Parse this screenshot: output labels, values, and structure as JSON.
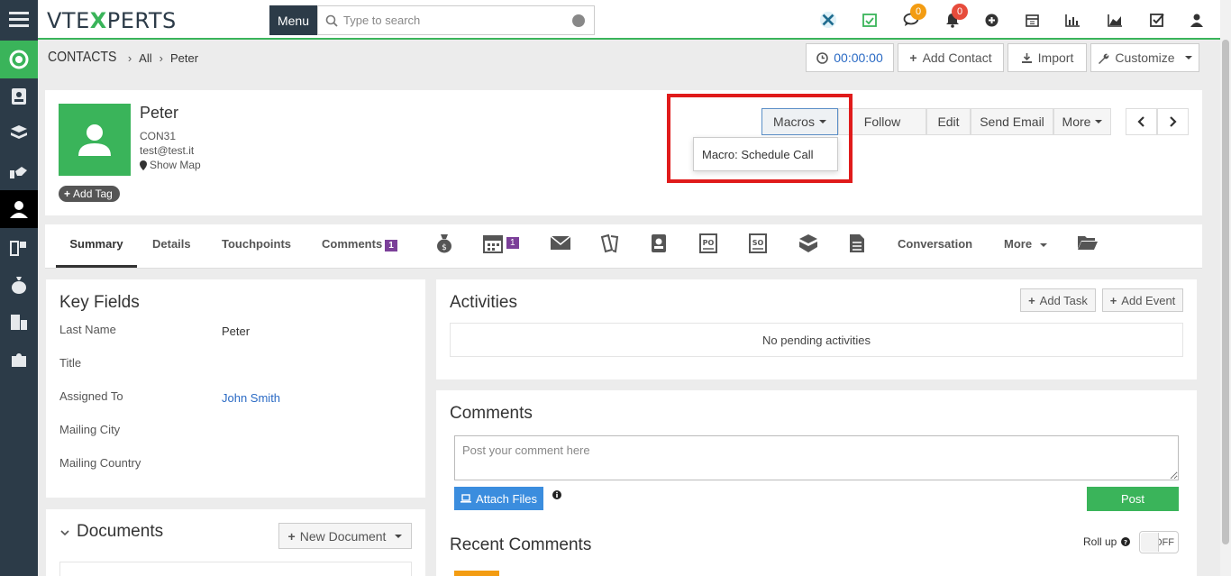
{
  "app": {
    "logo": "VTEXPERTS",
    "menu_label": "Menu"
  },
  "search": {
    "placeholder": "Type to search"
  },
  "topbar": {
    "badges": {
      "chat": "0",
      "notifications": "0"
    },
    "icons": [
      "vtiger-x-icon",
      "calendar-check-icon",
      "chat-icon",
      "bell-icon",
      "plus-circle-icon",
      "calendar-icon",
      "bar-chart-icon",
      "area-chart-icon",
      "checkbox-icon",
      "user-icon"
    ]
  },
  "breadcrumb": {
    "module": "CONTACTS",
    "filter": "All",
    "record": "Peter"
  },
  "header_buttons": {
    "timer": "00:00:00",
    "add_contact": "Add Contact",
    "import": "Import",
    "customize": "Customize"
  },
  "record": {
    "name": "Peter",
    "id": "CON31",
    "email": "test@test.it",
    "show_map": "Show Map",
    "add_tag": "Add Tag"
  },
  "actions": {
    "macros": "Macros",
    "follow": "Follow",
    "edit": "Edit",
    "send_email": "Send Email",
    "more": "More",
    "macro_item": "Macro: Schedule Call"
  },
  "tabs": {
    "summary": "Summary",
    "details": "Details",
    "touchpoints": "Touchpoints",
    "comments": "Comments",
    "comments_count": "1",
    "calendar_count": "1",
    "conversation": "Conversation",
    "more": "More"
  },
  "key_fields": {
    "title": "Key Fields",
    "rows": [
      {
        "label": "Last Name",
        "value": "Peter"
      },
      {
        "label": "Title",
        "value": ""
      },
      {
        "label": "Assigned To",
        "value": "John Smith"
      },
      {
        "label": "Mailing City",
        "value": ""
      },
      {
        "label": "Mailing Country",
        "value": ""
      }
    ]
  },
  "documents": {
    "title": "Documents",
    "new_document": "New Document"
  },
  "activities": {
    "title": "Activities",
    "add_task": "Add Task",
    "add_event": "Add Event",
    "empty": "No pending activities"
  },
  "comments": {
    "title": "Comments",
    "placeholder": "Post your comment here",
    "attach": "Attach Files",
    "post": "Post",
    "recent_title": "Recent Comments",
    "roll_up": "Roll up",
    "toggle": "OFF"
  },
  "colors": {
    "sidebar": "#2c3b48",
    "accent": "#3ab45a",
    "highlight": "#e01b1b",
    "primary": "#3b8dde"
  }
}
